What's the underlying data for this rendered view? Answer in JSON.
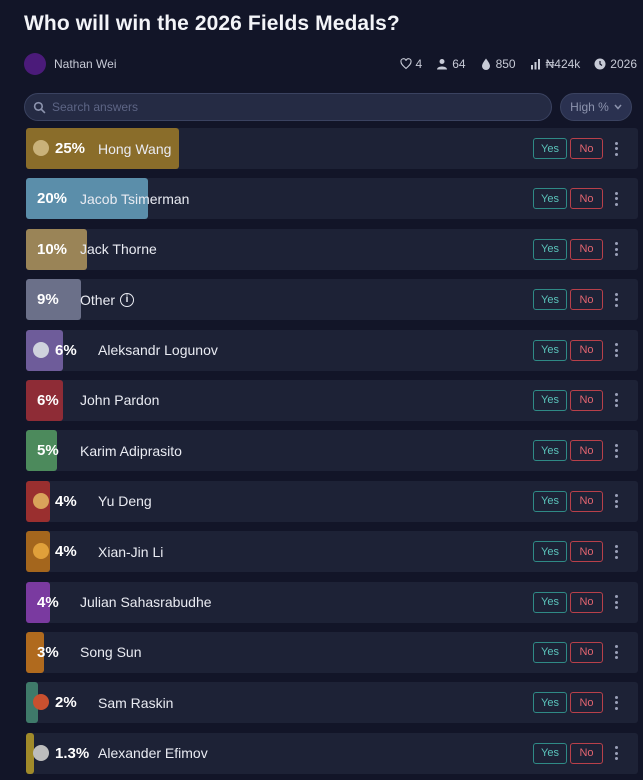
{
  "question": {
    "title": "Who will win the 2026 Fields Medals?"
  },
  "author": {
    "name": "Nathan Wei"
  },
  "stats": [
    {
      "icon": "heart-icon",
      "value": "4"
    },
    {
      "icon": "user-icon",
      "value": "64"
    },
    {
      "icon": "drop-icon",
      "value": "850"
    },
    {
      "icon": "volume-icon",
      "value": "₦424k"
    },
    {
      "icon": "clock-icon",
      "value": "2026"
    }
  ],
  "search": {
    "placeholder": "Search answers"
  },
  "sort": {
    "label": "High %"
  },
  "buttons": {
    "yes": "Yes",
    "no": "No"
  },
  "answers": [
    {
      "pct_label": "25%",
      "pct": 25,
      "name": "Hong Wang",
      "color": "#8a6d2a",
      "has_image": true,
      "image_color": "#c9b27a"
    },
    {
      "pct_label": "20%",
      "pct": 20,
      "name": "Jacob Tsimerman",
      "color": "#5b8eaa",
      "has_image": false
    },
    {
      "pct_label": "10%",
      "pct": 10,
      "name": "Jack Thorne",
      "color": "#9a8457",
      "has_image": false
    },
    {
      "pct_label": "9%",
      "pct": 9,
      "name": "Other",
      "color": "#6b7089",
      "has_image": false,
      "info": true
    },
    {
      "pct_label": "6%",
      "pct": 6,
      "name": "Aleksandr Logunov",
      "color": "#6e5c9a",
      "has_image": true,
      "image_color": "#cfd2dd"
    },
    {
      "pct_label": "6%",
      "pct": 6,
      "name": "John Pardon",
      "color": "#8e2c36",
      "has_image": false
    },
    {
      "pct_label": "5%",
      "pct": 5,
      "name": "Karim Adiprasito",
      "color": "#4c8a5c",
      "has_image": false
    },
    {
      "pct_label": "4%",
      "pct": 4,
      "name": "Yu Deng",
      "color": "#9a2f2f",
      "has_image": true,
      "image_color": "#d9a35a"
    },
    {
      "pct_label": "4%",
      "pct": 4,
      "name": "Xian-Jin Li",
      "color": "#a4661d",
      "has_image": true,
      "image_color": "#e0a03a"
    },
    {
      "pct_label": "4%",
      "pct": 4,
      "name": "Julian Sahasrabudhe",
      "color": "#7a3aa0",
      "has_image": false
    },
    {
      "pct_label": "3%",
      "pct": 3,
      "name": "Song Sun",
      "color": "#b06a1e",
      "has_image": false
    },
    {
      "pct_label": "2%",
      "pct": 2,
      "name": "Sam Raskin",
      "color": "#3f7a6a",
      "has_image": true,
      "image_color": "#c9502f"
    },
    {
      "pct_label": "1.3%",
      "pct": 1.3,
      "name": "Alexander Efimov",
      "color": "#a08a2a",
      "has_image": true,
      "image_color": "#bdbdbd"
    }
  ]
}
